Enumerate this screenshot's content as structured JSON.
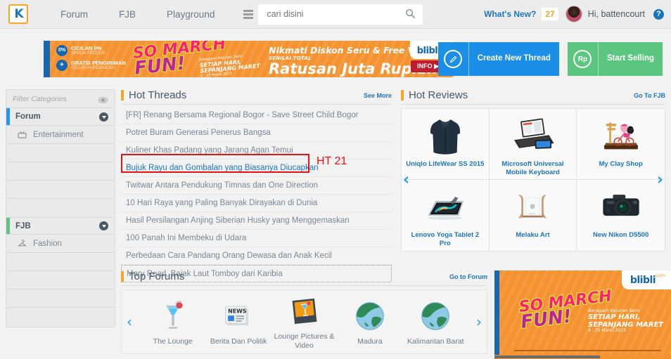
{
  "topnav": {
    "logo": "K",
    "links": [
      {
        "label": "Forum"
      },
      {
        "label": "FJB"
      },
      {
        "label": "Playground"
      }
    ],
    "menu_icon": "hamburger-icon",
    "search": {
      "value": "",
      "placeholder": "cari disini",
      "icon": "search-icon"
    },
    "whats_new": "What's New?",
    "notif_count": "27",
    "greeting": "Hi, battencourt",
    "help": "?"
  },
  "top_banner": {
    "badges": [
      {
        "circle": "0%",
        "title": "CICILAN 0%",
        "sub": "SEMUA PRODUK"
      },
      {
        "circle": "✈",
        "title": "GRATIS PENGIRIMAN",
        "sub": "SELURUH INDONESIA"
      }
    ],
    "so": "SO MARCH",
    "so_line1": "SO MARCH",
    "so_line2": "FUN!",
    "sub0": "Beragam Kejutan Seru",
    "sub1": "SETIAP HARI,",
    "sub2": "SEPANJANG MARET",
    "sub3": "4 - 25 Maret 2015",
    "main1": "Nikmati Diskon Seru & Free Voucher",
    "main2": "SENILAI TOTAL",
    "main3": "Ratusan Juta Rupiah",
    "info_btn": "INFO ▶",
    "brand": "blibli",
    "brand_tld": "com"
  },
  "cta": {
    "create_thread": "Create New\nThread",
    "create_thread_label": "Create New Thread",
    "create_icon": "pencil-icon",
    "start_selling": "Start Selling",
    "selling_icon": "rupiah-icon",
    "selling_icon_text": "Rp",
    "blue": "#1b8fe8",
    "green": "#5bc67f"
  },
  "sidebar": {
    "filter": {
      "placeholder": "Filter Categories",
      "value": "",
      "eye_icon": "eye-icon"
    },
    "sections": [
      {
        "title": "Forum",
        "accent": "#2196f3",
        "items": [
          {
            "label": "Entertainment",
            "icon": "tv-icon"
          }
        ],
        "blank_rows": 4
      },
      {
        "title": "FJB",
        "accent": "#5bc67f",
        "items": [
          {
            "label": "Fashion",
            "icon": "hanger-icon"
          }
        ],
        "blank_rows": 3
      }
    ]
  },
  "hot_threads": {
    "title": "Hot Threads",
    "link": "See More",
    "items": [
      {
        "label": "[FR] Renang Bersama Regional Bogor - Save Street Child Bogor",
        "state": "normal"
      },
      {
        "label": "Potret Buram Generasi Penerus Bangsa",
        "state": "normal"
      },
      {
        "label": "Kuliner Khas Padang yang Jarang Agan Temui",
        "state": "normal"
      },
      {
        "label": "Bujuk Rayu dan Gombalan yang Biasanya Diucapkan",
        "state": "highlighted"
      },
      {
        "label": "Twitwar Antara Pendukung Timnas dan One Direction",
        "state": "normal"
      },
      {
        "label": "10 Hari Raya yang Paling Banyak Dirayakan di Dunia",
        "state": "normal"
      },
      {
        "label": "Hasil Persilangan Anjing Siberian Husky yang Menggemaskan",
        "state": "normal"
      },
      {
        "label": "100 Panah Ini Membeku di Udara",
        "state": "normal"
      },
      {
        "label": "Perbedaan Cara Pandang Orang Dewasa dan Anak Kecil",
        "state": "normal"
      },
      {
        "label": "Mary Read, Bajak Laut Tomboy dari Karibia",
        "state": "focused"
      }
    ]
  },
  "annotation": {
    "label": "HT 21",
    "color": "#ee1111"
  },
  "hot_reviews": {
    "title": "Hot Reviews",
    "link": "Go To FJB",
    "prev": "‹",
    "next": "›",
    "items": [
      {
        "caption": "Uniqlo LifeWear SS 2015",
        "thumb": "hoodie-jacket"
      },
      {
        "caption": "Microsoft Universal Mobile Keyboard",
        "thumb": "tablet-keyboard"
      },
      {
        "caption": "My Clay Shop",
        "thumb": "clay-figurine"
      },
      {
        "caption": "Lenovo Yoga Tablet 2 Pro",
        "thumb": "yoga-tablet"
      },
      {
        "caption": "Melaku Art",
        "thumb": "wood-laptop-stand"
      },
      {
        "caption": "New Nikon D5500",
        "thumb": "dslr-camera"
      }
    ]
  },
  "top_forums": {
    "title": "Top Forums",
    "link": "Go to Forum",
    "prev": "‹",
    "next": "›",
    "items": [
      {
        "label": "The Lounge",
        "icon": "cocktail-glass-icon"
      },
      {
        "label": "Berita Dan Politik",
        "icon": "newspaper-icon"
      },
      {
        "label": "Lounge Pictures & Video",
        "icon": "photo-frame-icon"
      },
      {
        "label": "Madura",
        "icon": "globe-icon"
      },
      {
        "label": "Kalimantan Barat",
        "icon": "globe-icon"
      }
    ]
  },
  "bottom_banner": {
    "so_line1": "SO MARCH",
    "so_line2": "FUN!",
    "sub0": "Beragam Kejutan Seru",
    "sub1": "SETIAP HARI,",
    "sub2": "SEPANJANG MARET",
    "sub3": "4 - 25 Maret 2015",
    "brand": "blibli",
    "brand_tld": "com"
  }
}
